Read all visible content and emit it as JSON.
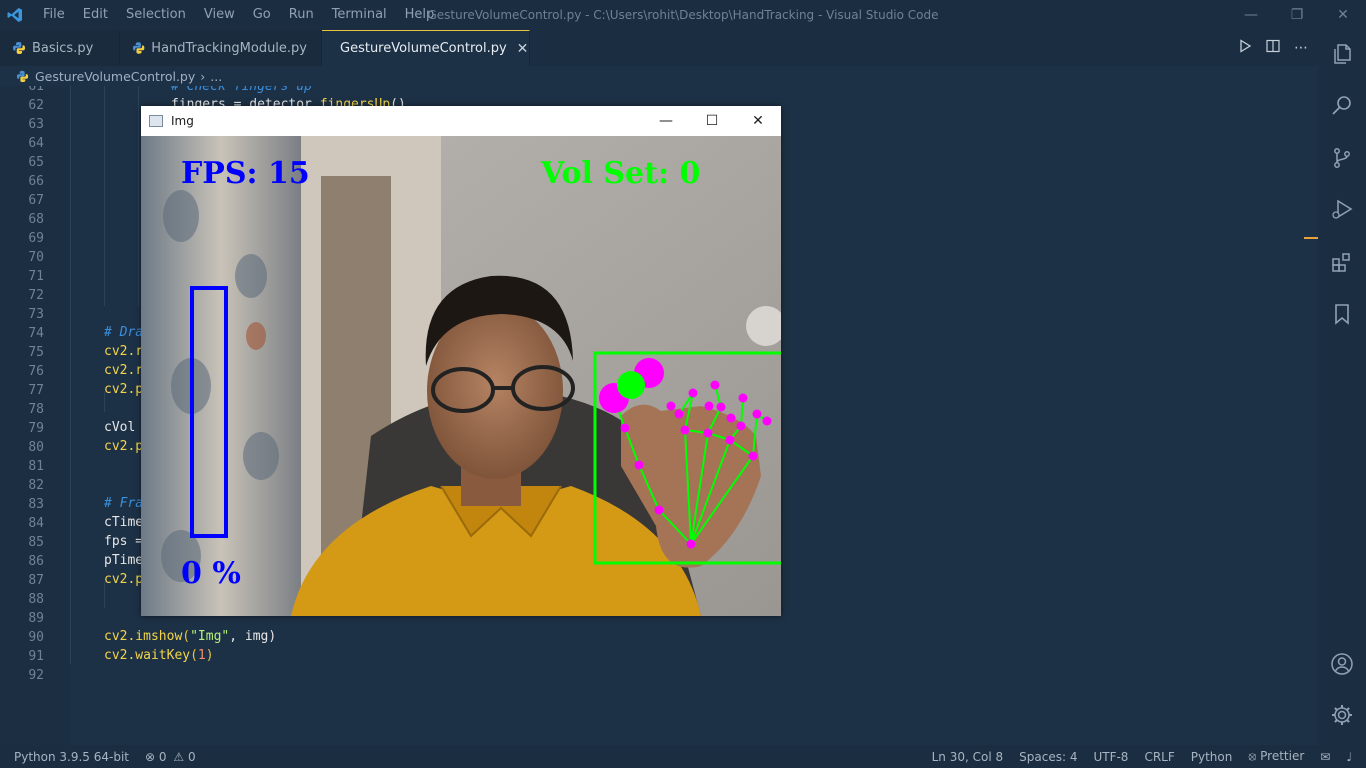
{
  "titlebar": {
    "menu": [
      "File",
      "Edit",
      "Selection",
      "View",
      "Go",
      "Run",
      "Terminal",
      "Help"
    ],
    "window_title": "GestureVolumeControl.py - C:\\Users\\rohit\\Desktop\\HandTracking - Visual Studio Code"
  },
  "tabs": [
    {
      "label": "Basics.py",
      "active": false
    },
    {
      "label": "HandTrackingModule.py",
      "active": false
    },
    {
      "label": "GestureVolumeControl.py",
      "active": true
    }
  ],
  "breadcrumb": {
    "file": "GestureVolumeControl.py",
    "sep": "›",
    "rest": "..."
  },
  "editor": {
    "line_numbers": [
      "61",
      "62",
      "63",
      "64",
      "65",
      "66",
      "67",
      "68",
      "69",
      "70",
      "71",
      "72",
      "73",
      "74",
      "75",
      "76",
      "77",
      "78",
      "79",
      "80",
      "81",
      "82",
      "83",
      "84",
      "85",
      "86",
      "87",
      "88",
      "89",
      "90",
      "91",
      "92"
    ],
    "partial_lines": {
      "l61": "# Check fingers up",
      "l62_a": "fingers = detector.",
      "l62_b": "fingersUp",
      "l62_c": "()",
      "l74": "# Dra",
      "l75": "cv2.r",
      "l76": "cv2.r",
      "l77": "cv2.p",
      "l79": "cVol",
      "l80": "cv2.p",
      "l83": "# Fra",
      "l84": "cTime",
      "l85": "fps =",
      "l86": "pTime",
      "l87": "cv2.p"
    },
    "l90": {
      "fn": "cv2.imshow",
      "open": "(",
      "str": "\"Img\"",
      "rest": ", img)"
    },
    "l91": {
      "fn": "cv2.waitKey",
      "open": "(",
      "num": "1",
      "close": ")"
    }
  },
  "img_window": {
    "title": "Img",
    "fps_text": "FPS: 15",
    "vol_set_text": "Vol Set: 0",
    "percent_text": "0 %",
    "volume_level": 0
  },
  "statusbar": {
    "python": "Python 3.9.5 64-bit",
    "errors": "0",
    "warnings": "0",
    "cursor": "Ln 30, Col 8",
    "spaces": "Spaces: 4",
    "encoding": "UTF-8",
    "eol": "CRLF",
    "language": "Python",
    "prettier": "Prettier"
  },
  "colors": {
    "accent_tab": "#e8c33c",
    "overlay_blue": "#0000ff",
    "overlay_green": "#00ff00",
    "landmark_magenta": "#ff00ff"
  }
}
